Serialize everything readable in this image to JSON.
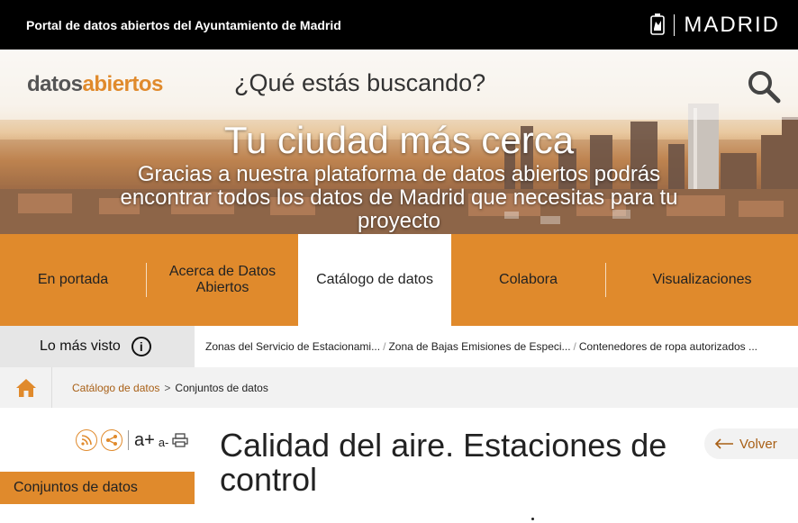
{
  "topbar": {
    "portal_title": "Portal de datos abiertos del Ayuntamiento de Madrid",
    "brand": "MADRID",
    "background": "#000000"
  },
  "header": {
    "logo_part1": "datos",
    "logo_part2": "abiertos",
    "search_placeholder": "¿Qué estás buscando?",
    "search_icon": "search-icon",
    "hero_title": "Tu ciudad más cerca",
    "hero_subtitle": "Gracias a nuestra plataforma de datos abiertos podrás encontrar todos los datos de Madrid que necesitas para tu proyecto"
  },
  "nav": {
    "items": [
      {
        "label": "En portada",
        "active": false
      },
      {
        "label": "Acerca de Datos Abiertos",
        "active": false
      },
      {
        "label": "Catálogo de datos",
        "active": true
      },
      {
        "label": "Colabora",
        "active": false
      },
      {
        "label": "Visualizaciones",
        "active": false
      }
    ],
    "accent": "#e08a2c"
  },
  "most_viewed": {
    "label": "Lo más visto",
    "info_icon": "info-icon",
    "links": [
      "Zonas del Servicio de Estacionami...",
      "Zona de Bajas Emisiones de Especi...",
      "Contenedores de ropa autorizados ..."
    ]
  },
  "breadcrumb": {
    "home_icon": "home-icon",
    "items": [
      "Catálogo de datos",
      "Conjuntos de datos"
    ],
    "separator": ">"
  },
  "tools": {
    "rss_icon": "rss-icon",
    "share_icon": "share-icon",
    "font_increase": "a+",
    "font_decrease": "a-",
    "print_icon": "print-icon"
  },
  "sidebar": {
    "active_item": "Conjuntos de datos"
  },
  "main": {
    "title": "Calidad del aire. Estaciones de control",
    "back_label": "Volver",
    "back_icon": "arrow-left-icon",
    "link_color": "#a85f15"
  }
}
